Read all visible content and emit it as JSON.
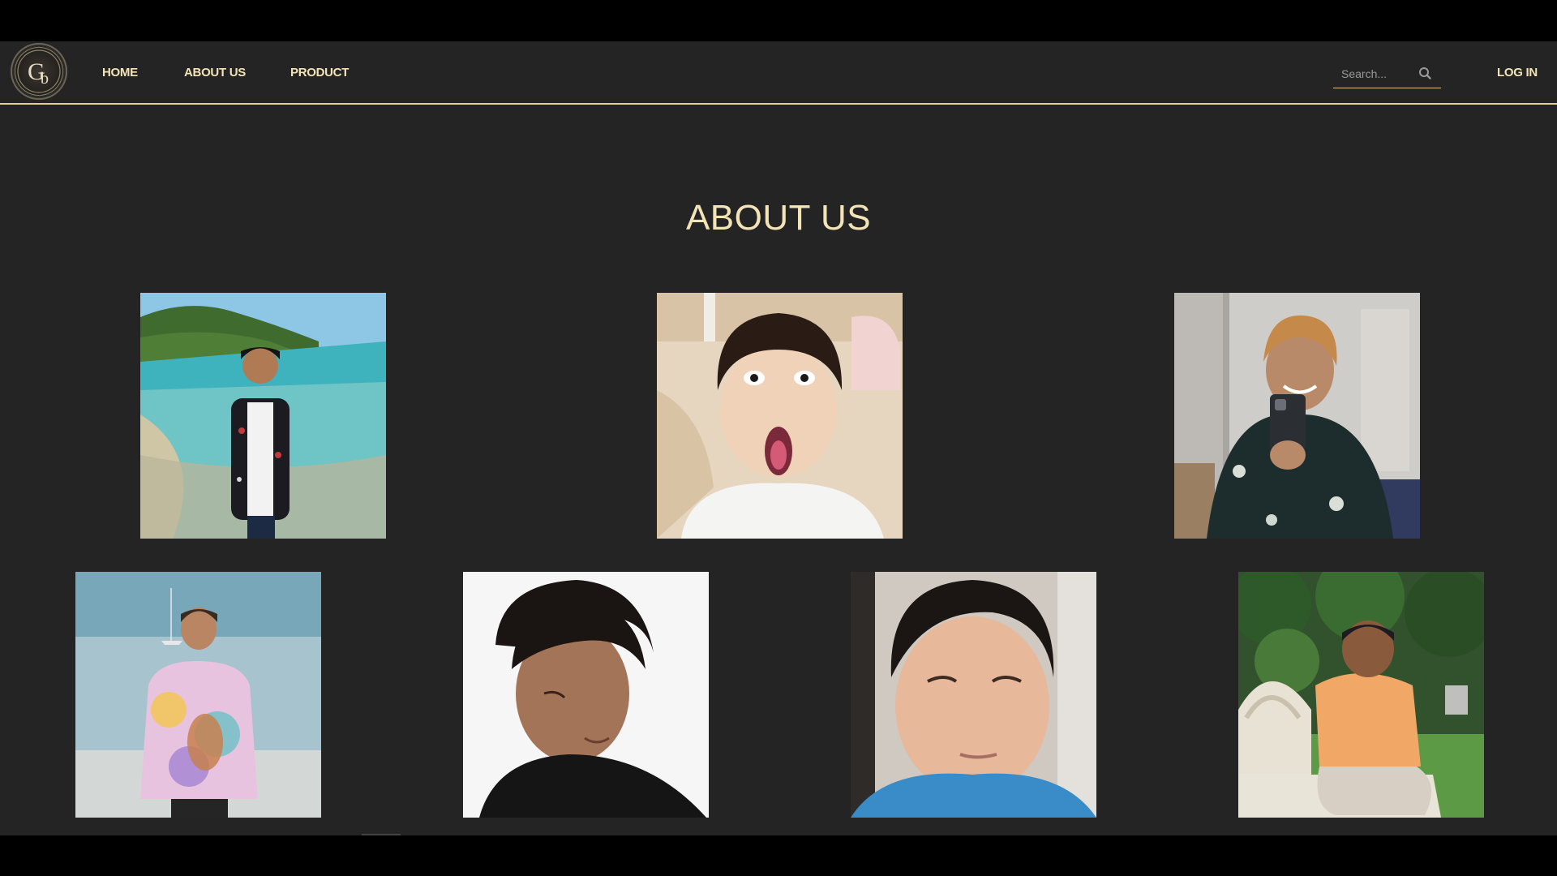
{
  "nav": {
    "home": "HOME",
    "about": "ABOUT US",
    "product": "PRODUCT",
    "login": "LOG IN"
  },
  "logo": {
    "letters": "Gb"
  },
  "search": {
    "placeholder": "Search..."
  },
  "page": {
    "title": "ABOUT US"
  },
  "colors": {
    "accent": "#f3e4b7",
    "nav_border": "#e3cf95",
    "background": "#242424",
    "letterbox": "#000000"
  },
  "icons": [
    "search-icon"
  ],
  "team_photos": [
    {
      "scene": "beach"
    },
    {
      "scene": "selfie-surprised"
    },
    {
      "scene": "mirror-selfie"
    },
    {
      "scene": "sea-tie-dye"
    },
    {
      "scene": "studio-portrait"
    },
    {
      "scene": "webcam"
    },
    {
      "scene": "garden-bench"
    }
  ]
}
